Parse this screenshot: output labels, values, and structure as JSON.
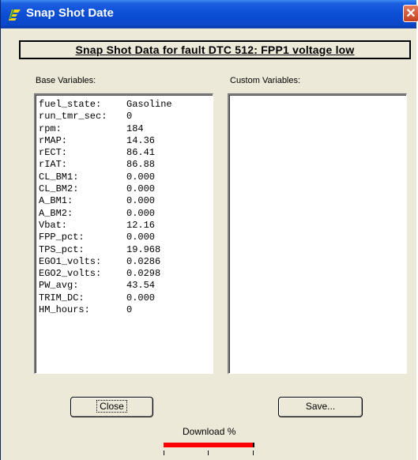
{
  "window": {
    "title": "Snap Shot Date",
    "close_glyph": "✕"
  },
  "header": {
    "text": "Snap Shot Data for fault DTC 512: FPP1 voltage low"
  },
  "base_label": "Base Variables:",
  "custom_label": "Custom Variables:",
  "base_variables": [
    {
      "name": "fuel_state:",
      "value": "Gasoline"
    },
    {
      "name": "run_tmr_sec:",
      "value": "0"
    },
    {
      "name": "rpm:",
      "value": "184"
    },
    {
      "name": "rMAP:",
      "value": "14.36"
    },
    {
      "name": "rECT:",
      "value": "86.41"
    },
    {
      "name": "rIAT:",
      "value": "86.88"
    },
    {
      "name": "CL_BM1:",
      "value": "0.000"
    },
    {
      "name": "CL_BM2:",
      "value": "0.000"
    },
    {
      "name": "A_BM1:",
      "value": "0.000"
    },
    {
      "name": "A_BM2:",
      "value": "0.000"
    },
    {
      "name": "Vbat:",
      "value": "12.16"
    },
    {
      "name": "FPP_pct:",
      "value": "0.000"
    },
    {
      "name": "TPS_pct:",
      "value": "19.968"
    },
    {
      "name": "EGO1_volts:",
      "value": "0.0286"
    },
    {
      "name": "EGO2_volts:",
      "value": "0.0298"
    },
    {
      "name": "PW_avg:",
      "value": "43.54"
    },
    {
      "name": "TRIM_DC:",
      "value": "0.000"
    },
    {
      "name": "HM_hours:",
      "value": "0"
    }
  ],
  "custom_variables": [],
  "buttons": {
    "close": "Close",
    "save": "Save..."
  },
  "download": {
    "label": "Download %",
    "progress": 1.0
  },
  "colors": {
    "titlebar": "#0a46c8",
    "progress": "#ff0000",
    "background": "#ece9d8"
  },
  "icons": {
    "app": "app-logo-icon",
    "close": "close-icon"
  }
}
